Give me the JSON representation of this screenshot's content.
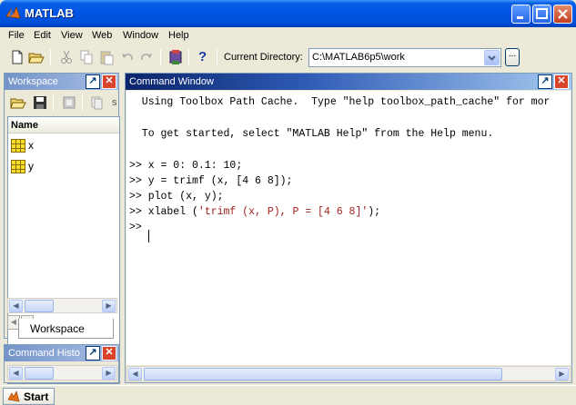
{
  "window": {
    "title": "MATLAB"
  },
  "menu": [
    "File",
    "Edit",
    "View",
    "Web",
    "Window",
    "Help"
  ],
  "toolbar": {
    "current_directory_label": "Current Directory:",
    "current_directory_value": "C:\\MATLAB6p5\\work",
    "browse_label": "...",
    "help_label": "?"
  },
  "workspace": {
    "title": "Workspace",
    "column_header": "Name",
    "variables": [
      "x",
      "y"
    ],
    "tab_label": "Workspace"
  },
  "command_history": {
    "title": "Command Histo"
  },
  "command_window": {
    "title": "Command Window",
    "lines": [
      "  Using Toolbox Path Cache.  Type \"help toolbox_path_cache\" for mor",
      "",
      "  To get started, select \"MATLAB Help\" from the Help menu.",
      "",
      ">> x = 0: 0.1: 10;",
      ">> y = trimf (x, [4 6 8]);",
      ">> plot (x, y);"
    ],
    "xlabel_prefix": ">> xlabel (",
    "xlabel_string": "'trimf (x, P), P = [4 6 8]'",
    "xlabel_suffix": ");",
    "prompt": ">>"
  },
  "taskbar": {
    "start_label": "Start"
  },
  "colors": {
    "title_bar": "#0054e3",
    "string_literal": "#a02020",
    "window_bg": "#ece9d8"
  }
}
